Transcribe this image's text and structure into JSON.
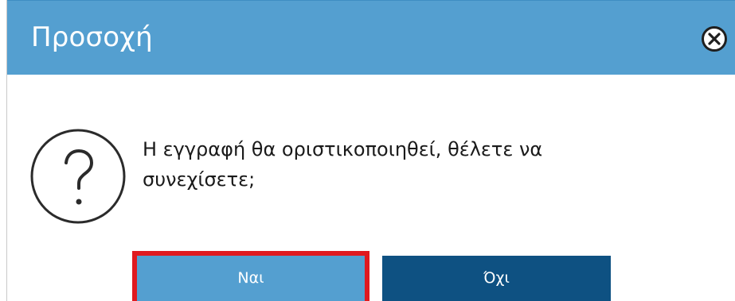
{
  "dialog": {
    "title": "Προσοχή",
    "message_line1": "Η εγγραφή θα οριστικοποιηθεί, θέλετε να",
    "message_line2": "συνεχίσετε;",
    "yes_label": "Ναι",
    "no_label": "Όχι"
  },
  "icons": {
    "close": "close-circle-icon",
    "question": "question-mark-circle-icon"
  },
  "colors": {
    "title_bar": "#549fd0",
    "yes_button": "#549fd0",
    "no_button": "#0e5182",
    "highlight": "#e0191f"
  }
}
